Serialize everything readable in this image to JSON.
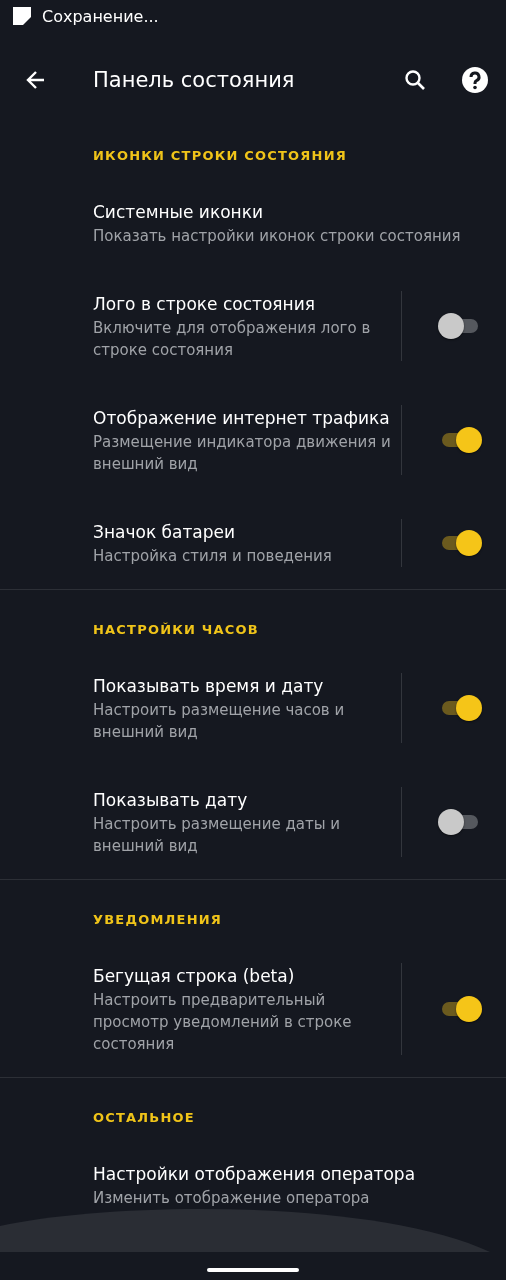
{
  "status_bar": {
    "text": "Сохранение..."
  },
  "toolbar": {
    "title": "Панель состояния"
  },
  "sections": [
    {
      "header": "ИКОНКИ СТРОКИ СОСТОЯНИЯ",
      "items": [
        {
          "kind": "link",
          "title": "Системные иконки",
          "subtitle": "Показать настройки иконок строки состояния"
        },
        {
          "kind": "switch",
          "title": "Лого в строке состояния",
          "subtitle": "Включите для отображения лого в строке состояния",
          "on": false
        },
        {
          "kind": "switch",
          "title": "Отображение интернет трафика",
          "subtitle": "Размещение индикатора движения и внешний вид",
          "on": true
        },
        {
          "kind": "switch",
          "title": "Значок батареи",
          "subtitle": "Настройка стиля и поведения",
          "on": true
        }
      ]
    },
    {
      "header": "НАСТРОЙКИ ЧАСОВ",
      "items": [
        {
          "kind": "switch",
          "title": "Показывать время и дату",
          "subtitle": "Настроить размещение часов и внешний вид",
          "on": true
        },
        {
          "kind": "switch",
          "title": "Показывать дату",
          "subtitle": "Настроить размещение даты и внешний вид",
          "on": false
        }
      ]
    },
    {
      "header": "УВЕДОМЛЕНИЯ",
      "items": [
        {
          "kind": "switch",
          "title": "Бегущая строка (beta)",
          "subtitle": "Настроить предварительный просмотр уведомлений в строке состояния",
          "on": true
        }
      ]
    },
    {
      "header": "ОСТАЛЬНОЕ",
      "items": [
        {
          "kind": "link",
          "title": "Настройки отображения оператора",
          "subtitle": "Изменить отображение оператора"
        }
      ]
    }
  ]
}
